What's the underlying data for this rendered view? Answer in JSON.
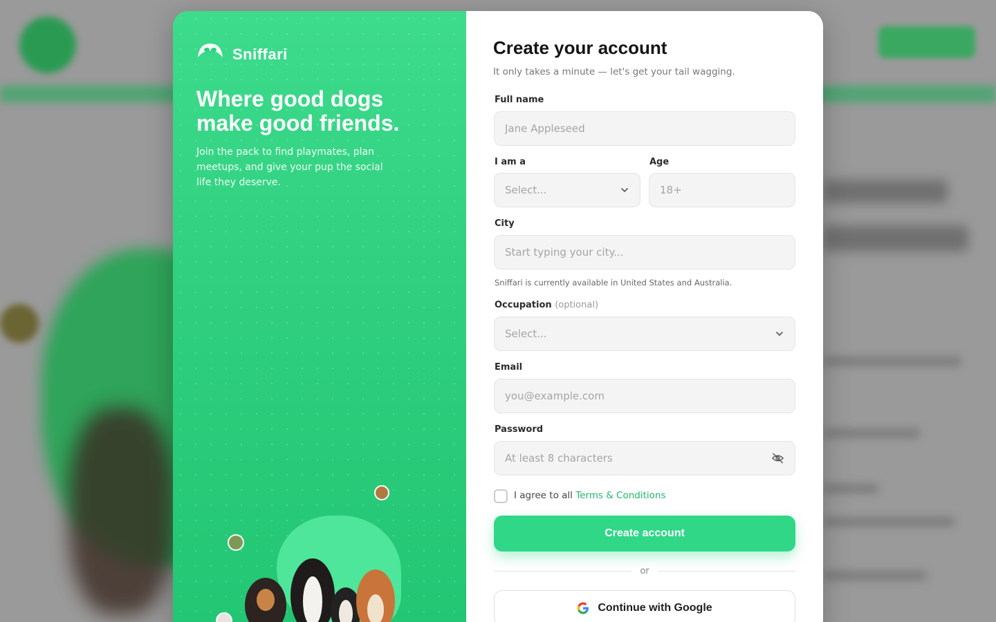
{
  "brand": {
    "name": "Sniffari"
  },
  "hero": {
    "title": "Where good dogs make good friends.",
    "subtitle": "Join the pack to find playmates, plan meetups, and give your pup the social life they deserve."
  },
  "form": {
    "title": "Create your account",
    "subtitle": "It only takes a minute — let's get your tail wagging.",
    "full_name": {
      "label": "Full name",
      "placeholder": "Jane Appleseed"
    },
    "i_am_a": {
      "label": "I am a",
      "value": "Select..."
    },
    "age": {
      "label": "Age",
      "placeholder": "18+"
    },
    "city": {
      "label": "City",
      "placeholder": "Start typing your city...",
      "hint": "Sniffari is currently available in United States and Australia."
    },
    "occupation": {
      "label": "Occupation",
      "optional": "(optional)",
      "value": "Select..."
    },
    "email": {
      "label": "Email",
      "placeholder": "you@example.com"
    },
    "password": {
      "label": "Password",
      "placeholder": "At least 8 characters"
    },
    "agree_prefix": "I agree to all",
    "terms_link": "Terms & Conditions",
    "submit": "Create account",
    "divider": "or",
    "google": "Continue with Google"
  },
  "colors": {
    "accent": "#2fd787",
    "panel": "#2fcf7f",
    "link": "#1fb86a"
  },
  "icons": {
    "select": "chevron-down-icon",
    "password": "eye-off-icon",
    "google": "google-icon"
  }
}
